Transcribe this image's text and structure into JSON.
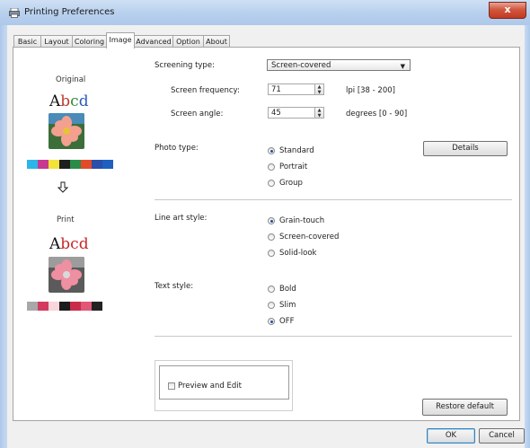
{
  "window": {
    "title": "Printing Preferences",
    "close_label": "x"
  },
  "tabs": [
    {
      "label": "Basic"
    },
    {
      "label": "Layout"
    },
    {
      "label": "Coloring"
    },
    {
      "label": "Image"
    },
    {
      "label": "Advanced"
    },
    {
      "label": "Option"
    },
    {
      "label": "About"
    }
  ],
  "active_tab": "Image",
  "preview": {
    "original_label": "Original",
    "print_label": "Print",
    "sample_text": {
      "a": "A",
      "b": "b",
      "c": "c",
      "d": "d"
    },
    "original_swatches": [
      "#2bb5e8",
      "#c8388f",
      "#f2e33b",
      "#1f1f1f",
      "#2a8c47",
      "#e24a2a",
      "#2b4ea8",
      "#1f5fbf"
    ],
    "print_swatches": [
      "#a8a8a8",
      "#d43a5f",
      "#f7d6dc",
      "#1c1c1c",
      "#c92b4b",
      "#e05777",
      "#222222"
    ]
  },
  "form": {
    "screening_type": {
      "label": "Screening type:",
      "value": "Screen-covered"
    },
    "screen_frequency": {
      "label": "Screen frequency:",
      "value": "71",
      "range": "lpi [38 - 200]"
    },
    "screen_angle": {
      "label": "Screen angle:",
      "value": "45",
      "range": "degrees [0 - 90]"
    },
    "photo_type": {
      "label": "Photo type:",
      "options": [
        "Standard",
        "Portrait",
        "Group"
      ],
      "selected": "Standard"
    },
    "details_button": "Details",
    "line_art_style": {
      "label": "Line art style:",
      "options": [
        "Grain-touch",
        "Screen-covered",
        "Solid-look"
      ],
      "selected": "Grain-touch"
    },
    "text_style": {
      "label": "Text style:",
      "options": [
        "Bold",
        "Slim",
        "OFF"
      ],
      "selected": "OFF"
    },
    "preview_edit": {
      "label": "Preview and Edit",
      "checked": false
    },
    "restore_button": "Restore default"
  },
  "footer": {
    "ok": "OK",
    "cancel": "Cancel"
  },
  "colors": {
    "accent": "#1f4f9e",
    "sample_red": "#c0392b",
    "sample_green": "#2e8b3a",
    "sample_blue": "#2a5bbf"
  }
}
